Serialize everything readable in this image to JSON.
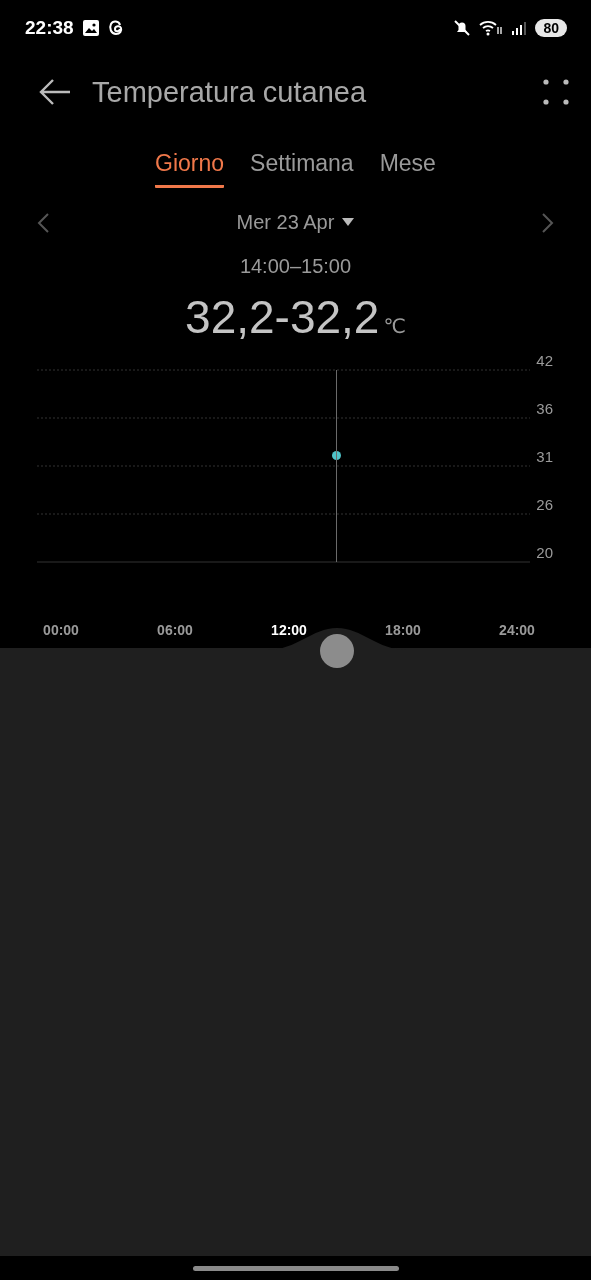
{
  "status_bar": {
    "time": "22:38",
    "battery": "80"
  },
  "header": {
    "title": "Temperatura cutanea"
  },
  "tabs": [
    {
      "label": "Giorno",
      "selected": true
    },
    {
      "label": "Settimana",
      "selected": false
    },
    {
      "label": "Mese",
      "selected": false
    }
  ],
  "date_selector": {
    "label": "Mer 23 Apr"
  },
  "time_range": "14:00–15:00",
  "reading": {
    "value": "32,2-32,2",
    "unit": "℃"
  },
  "chart": {
    "chart_data": {
      "type": "scatter",
      "x": [
        14.5
      ],
      "series": [
        {
          "color": "#4fc3c8",
          "values": [
            32.2
          ]
        }
      ],
      "grid": true,
      "ref_lines": [
        {
          "axis": "x",
          "value": 14.5
        }
      ],
      "xlim": [
        0,
        24
      ],
      "ylim": [
        20,
        42
      ],
      "yticks": [
        20,
        {
          "value": 25.5,
          "label": "26"
        },
        31,
        {
          "value": 36.5,
          "label": "36"
        },
        42
      ],
      "xticks": [
        {
          "value": 0,
          "label": "00:00"
        },
        {
          "value": 6,
          "label": "06:00"
        },
        {
          "value": 12,
          "label": "12:00"
        },
        {
          "value": 18,
          "label": "18:00"
        },
        {
          "value": 24,
          "label": "24:00"
        }
      ]
    }
  }
}
